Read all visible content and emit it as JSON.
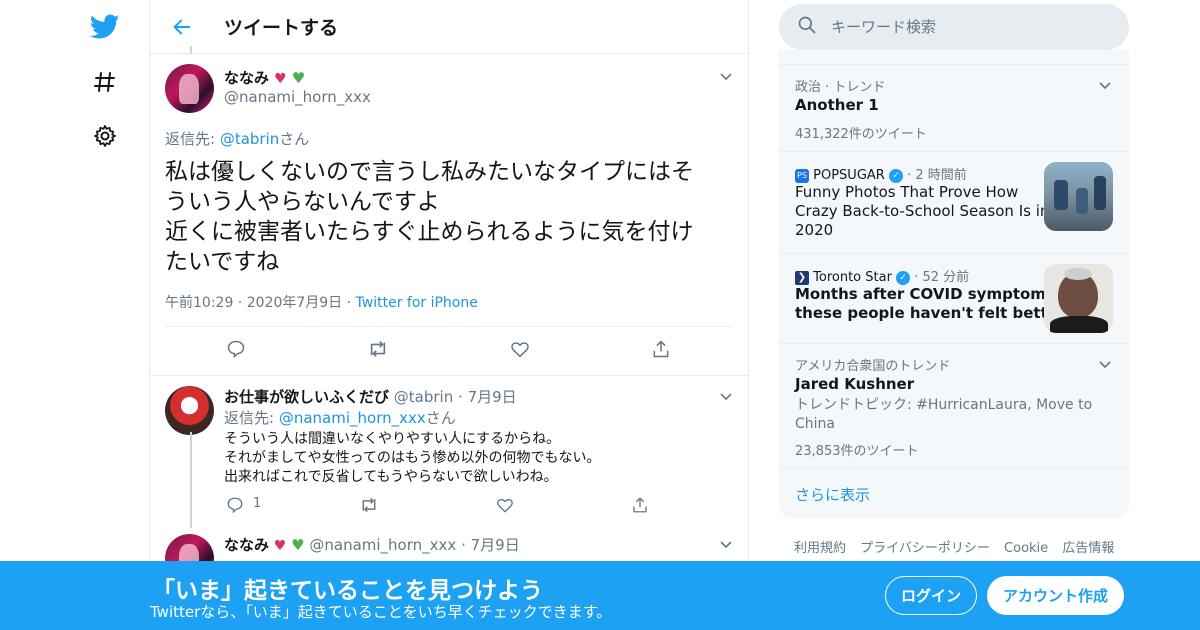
{
  "nav": {
    "icons": [
      "twitter-bird-icon",
      "hashtag-icon",
      "gear-icon"
    ]
  },
  "header": {
    "title": "ツイートする"
  },
  "focus_tweet": {
    "name": "ななみ",
    "handle": "@nanami_horn_xxx",
    "reply_prefix": "返信先: ",
    "reply_to": "@tabrin",
    "reply_suffix": "さん",
    "text_line1": "私は優しくないので言うし私みたいなタイプにはそ",
    "text_line2": "ういう人やらないんですよ",
    "text_line3": "近くに被害者いたらすぐ止められるように気を付け",
    "text_line4": "たいですね",
    "time": "午前10:29",
    "date": "2020年7月9日",
    "source": "Twitter for iPhone"
  },
  "reply1": {
    "name": "お仕事が欲しいふくだび",
    "handle": "@tabrin",
    "date": "7月9日",
    "reply_prefix": "返信先: ",
    "reply_to": "@nanami_horn_xxx",
    "reply_suffix": "さん",
    "line1": "そういう人は間違いなくやりやすい人にするからね。",
    "line2": "それがましてや女性ってのはもう惨め以外の何物でもない。",
    "line3": "出来ればこれで反省してもうやらないで欲しいわね。",
    "reply_count": "1"
  },
  "reply2": {
    "name": "ななみ",
    "handle": "@nanami_horn_xxx",
    "date": "7月9日"
  },
  "search": {
    "placeholder": "キーワード検索"
  },
  "trends": [
    {
      "context": "政治 · トレンド",
      "title": "Another 1",
      "count": "431,322件のツイート"
    },
    {
      "source": "POPSUGAR",
      "time": "2 時間前",
      "title1": "Funny Photos That Prove How",
      "title2": "Crazy Back-to-School Season Is in",
      "title3": "2020"
    },
    {
      "source": "Toronto Star",
      "time": "52 分前",
      "title1": "Months after COVID symptoms,",
      "title2": "these people haven't felt better"
    },
    {
      "context": "アメリカ合衆国のトレンド",
      "title": "Jared Kushner",
      "topic1": "トレンドトピック: #HurricanLaura, Move to",
      "topic2": "China",
      "count": "23,853件のツイート"
    }
  ],
  "show_more": "さらに表示",
  "footer": [
    "利用規約",
    "プライバシーポリシー",
    "Cookie",
    "広告情報"
  ],
  "banner": {
    "title": "「いま」起きていることを見つけよう",
    "subtitle": "Twitterなら、「いま」起きていることをいち早くチェックできます。",
    "login": "ログイン",
    "signup": "アカウント作成"
  },
  "colors": {
    "accent": "#1da1f2",
    "link": "#1b95e0",
    "text": "#14171a",
    "muted": "#657786",
    "border": "#e6ecf0",
    "panel": "#f5f8fa"
  }
}
